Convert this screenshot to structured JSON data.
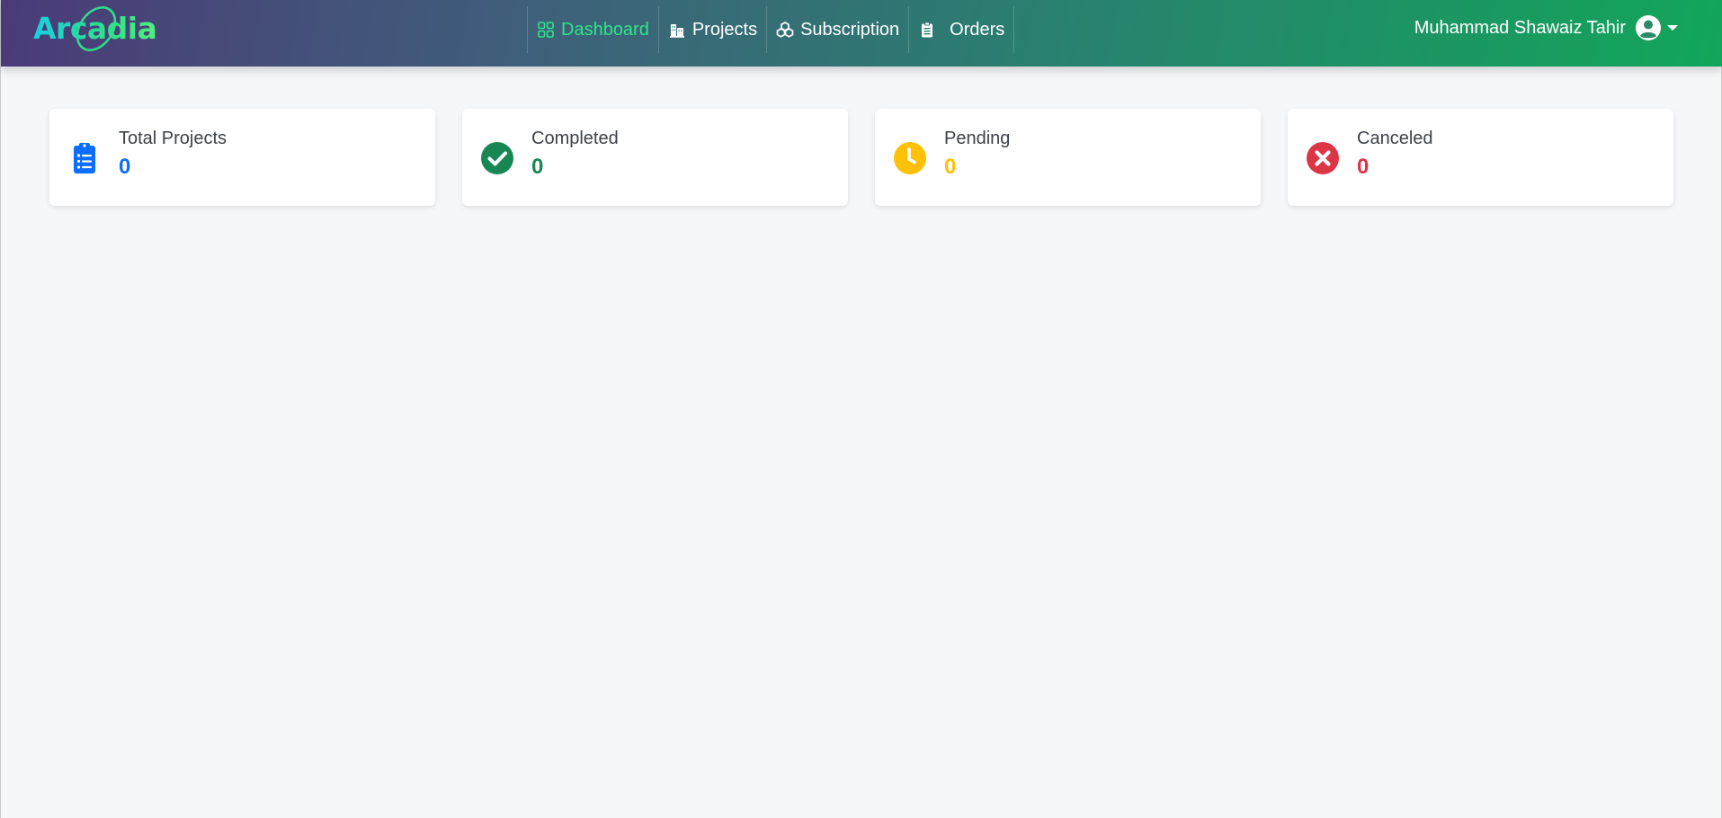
{
  "brand": {
    "name": "Arcadia"
  },
  "nav": {
    "items": [
      {
        "label": "Dashboard",
        "icon": "grid-icon",
        "active": true
      },
      {
        "label": "Projects",
        "icon": "buildings-icon"
      },
      {
        "label": "Subscription",
        "icon": "boxes-icon"
      },
      {
        "label": "Orders",
        "icon": "clipboard-icon"
      }
    ]
  },
  "user": {
    "name": "Muhammad Shawaiz Tahir",
    "icon": "user-circle-icon"
  },
  "stats": [
    {
      "label": "Total Projects",
      "value": "0",
      "icon": "clipboard-list-icon",
      "color": "#0d6efd"
    },
    {
      "label": "Completed",
      "value": "0",
      "icon": "check-circle-icon",
      "color": "#198754"
    },
    {
      "label": "Pending",
      "value": "0",
      "icon": "clock-icon",
      "color": "#ffc107"
    },
    {
      "label": "Canceled",
      "value": "0",
      "icon": "x-circle-icon",
      "color": "#dc3545"
    }
  ],
  "colors": {
    "active_nav": "#2ee68a",
    "page_bg": "#f6f7f9"
  }
}
